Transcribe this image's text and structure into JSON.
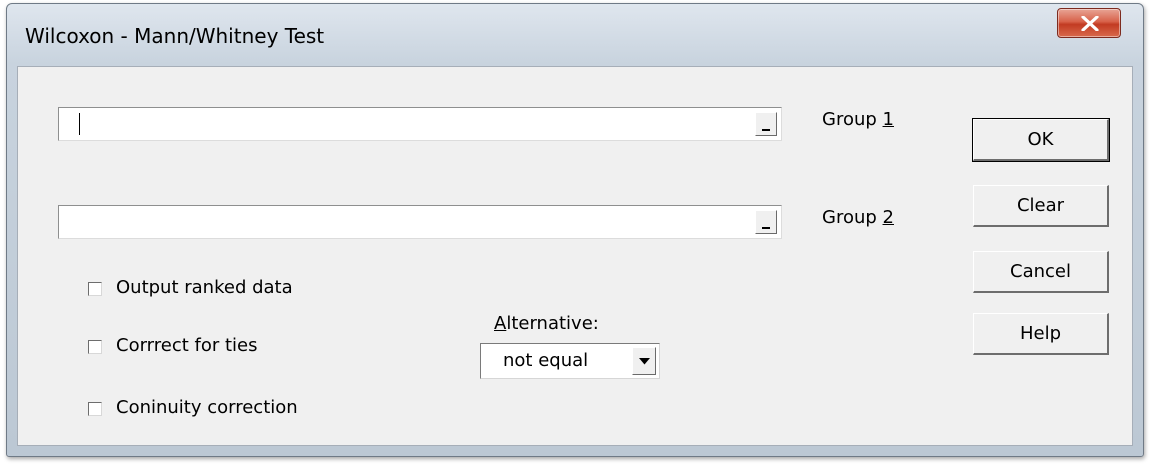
{
  "window": {
    "title": "Wilcoxon - Mann/Whitney Test",
    "close_icon": "close-icon"
  },
  "inputs": {
    "group1": {
      "value": "",
      "label_prefix": "Group ",
      "label_key": "1"
    },
    "group2": {
      "value": "",
      "label_prefix": "Group ",
      "label_key": "2"
    }
  },
  "options": [
    {
      "label": "Output ranked data",
      "checked": false
    },
    {
      "label": "Corrrect for ties",
      "checked": false
    },
    {
      "label": "Coninuity correction",
      "checked": false
    }
  ],
  "alternative": {
    "label_key": "A",
    "label_rest": "lternative:",
    "selected": "not equal"
  },
  "buttons": {
    "ok": "OK",
    "clear": "Clear",
    "cancel": "Cancel",
    "help": "Help"
  },
  "colors": {
    "close_button": "#c7432a",
    "dialog_face": "#f0f0f0",
    "frame": "#c8d3de"
  }
}
